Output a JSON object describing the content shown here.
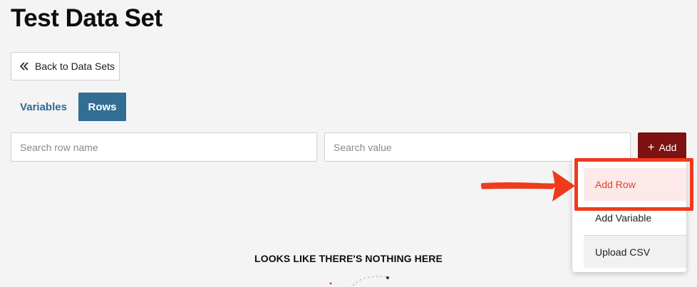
{
  "page": {
    "title": "Test Data Set"
  },
  "back_button": {
    "label": "Back to Data Sets",
    "icon": "double-chevron-left-icon"
  },
  "tabs": [
    {
      "label": "Variables",
      "active": false
    },
    {
      "label": "Rows",
      "active": true
    }
  ],
  "search": {
    "row_name_placeholder": "Search row name",
    "row_name_value": "",
    "value_placeholder": "Search value",
    "value_value": ""
  },
  "add_button": {
    "label": "Add",
    "icon": "plus-icon"
  },
  "add_menu": {
    "items": [
      {
        "label": "Add Row",
        "highlighted": true
      },
      {
        "label": "Add Variable",
        "highlighted": false
      },
      {
        "label": "Upload CSV",
        "highlighted": false
      }
    ]
  },
  "empty_state": {
    "text": "LOOKS LIKE THERE'S NOTHING HERE"
  },
  "colors": {
    "primary": "#326d94",
    "add_button": "#7e1111",
    "annotation": "#ef3a1c",
    "highlight_bg": "#fde9e9"
  }
}
